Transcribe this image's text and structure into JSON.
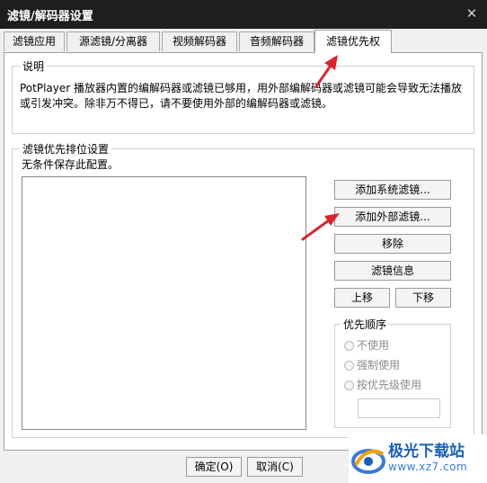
{
  "window": {
    "title": "滤镜/解码器设置",
    "close_glyph": "✕"
  },
  "tabs": [
    {
      "label": "滤镜应用"
    },
    {
      "label": "源滤镜/分离器"
    },
    {
      "label": "视频解码器"
    },
    {
      "label": "音频解码器"
    },
    {
      "label": "滤镜优先权",
      "active": true
    }
  ],
  "description": {
    "legend": "说明",
    "text": "PotPlayer 播放器内置的编解码器或滤镜已够用，用外部编解码器或滤镜可能会导致无法播放或引发冲突。除非万不得已，请不要使用外部的编解码器或滤镜。"
  },
  "priority_settings": {
    "legend": "滤镜优先排位设置",
    "note": "无条件保存此配置。",
    "buttons": {
      "add_system": "添加系统滤镜...",
      "add_external": "添加外部滤镜...",
      "remove": "移除",
      "filter_info": "滤镜信息",
      "move_up": "上移",
      "move_down": "下移"
    },
    "priority_order": {
      "legend": "优先顺序",
      "options": [
        "不使用",
        "强制使用",
        "按优先级使用"
      ]
    }
  },
  "footer": {
    "ok": "确定(O)",
    "cancel": "取消(C)"
  },
  "watermark": {
    "main": "极光下载站",
    "sub": "www.xz7.com"
  },
  "colors": {
    "titlebar": "#1e1e1e",
    "annotation_arrow": "#d9262c",
    "watermark_blue": "#1a5fb4"
  }
}
